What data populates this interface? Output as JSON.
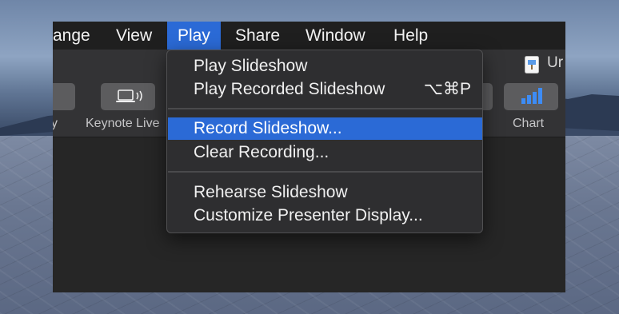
{
  "menubar": {
    "items": [
      "ange",
      "View",
      "Play",
      "Share",
      "Window",
      "Help"
    ],
    "active": "Play"
  },
  "toolbar": {
    "left_label": "y",
    "keynote_live_label": "Keynote Live",
    "chart_label": "Chart",
    "document_title": "Ur"
  },
  "play_menu": {
    "items": [
      {
        "label": "Play Slideshow",
        "shortcut": ""
      },
      {
        "label": "Play Recorded Slideshow",
        "shortcut": "⌥⌘P"
      },
      {
        "label": "Record Slideshow...",
        "shortcut": "",
        "highlighted": true
      },
      {
        "label": "Clear Recording...",
        "shortcut": ""
      },
      {
        "label": "Rehearse Slideshow",
        "shortcut": ""
      },
      {
        "label": "Customize Presenter Display...",
        "shortcut": ""
      }
    ]
  },
  "colors": {
    "accent": "#2b6ad6",
    "menu_bg": "#2e2e30",
    "chart_icon": "#3d8cf5"
  },
  "icons": {
    "keynote_live": "screen-broadcast-icon",
    "chart": "bar-chart-icon",
    "document": "keynote-document-icon"
  }
}
